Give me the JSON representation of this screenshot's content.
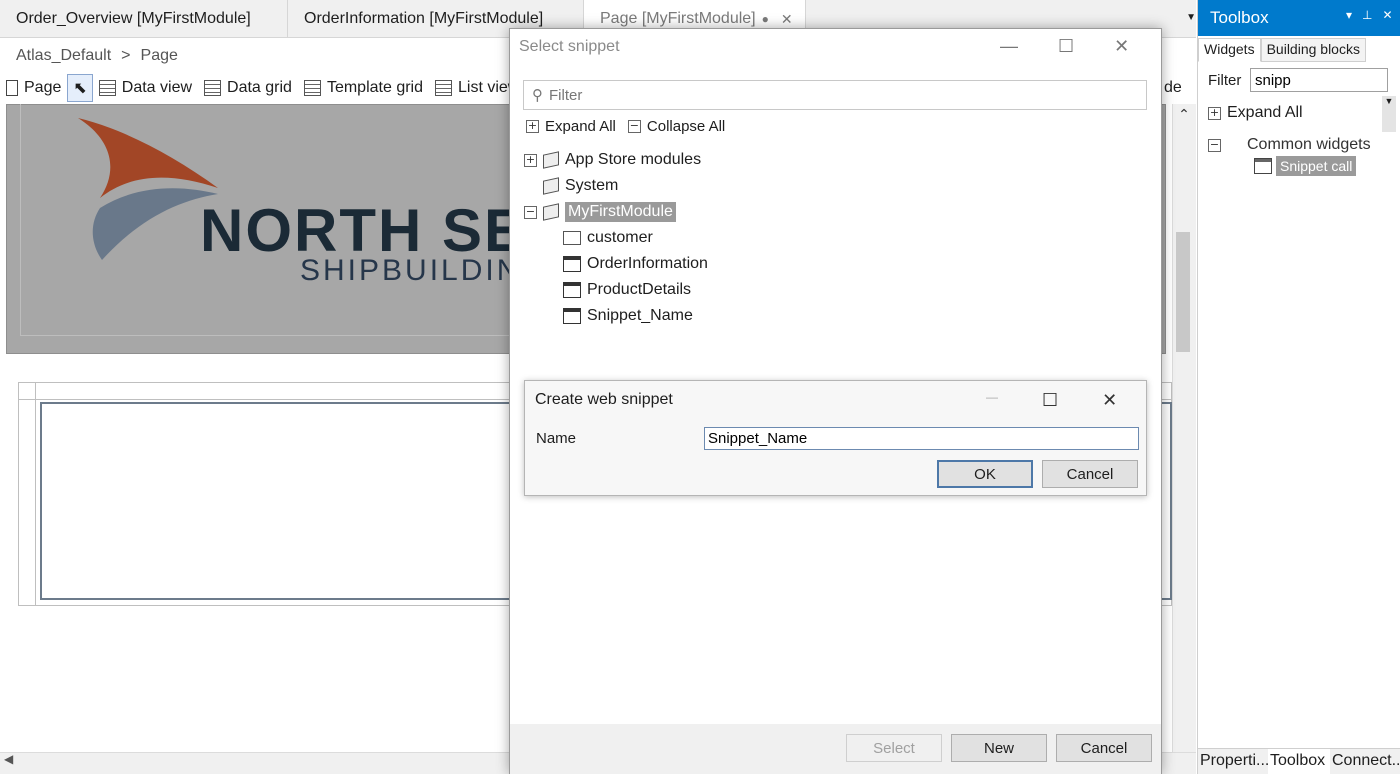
{
  "tabs": [
    {
      "label": "Order_Overview [MyFirstModule]"
    },
    {
      "label": "OrderInformation [MyFirstModule]"
    },
    {
      "label": "Page [MyFirstModule]"
    }
  ],
  "breadcrumb": {
    "first": "Atlas_Default",
    "sep": ">",
    "second": "Page"
  },
  "toolbar": {
    "page": "Page",
    "data_view": "Data view",
    "data_grid": "Data grid",
    "template_grid": "Template grid",
    "list_view": "List view",
    "partial_right": "de"
  },
  "canvas": {
    "logo_line1": "NORTH SEA",
    "logo_line2": "SHIPBUILDING"
  },
  "toolbox": {
    "title": "Toolbox",
    "tab_widgets": "Widgets",
    "tab_building_blocks": "Building blocks",
    "filter_label": "Filter",
    "filter_value": "snipp",
    "expand_all": "Expand All",
    "category": "Common widgets",
    "item": "Snippet call",
    "bottom_tabs": [
      "Properti...",
      "Toolbox",
      "Connect..."
    ]
  },
  "select_snippet": {
    "title": "Select snippet",
    "filter_placeholder": "Filter",
    "expand_all": "Expand All",
    "collapse_all": "Collapse All",
    "tree": {
      "app_store": "App Store modules",
      "system": "System",
      "my_module": "MyFirstModule",
      "children": [
        "customer",
        "OrderInformation",
        "ProductDetails",
        "Snippet_Name"
      ]
    },
    "buttons": {
      "select": "Select",
      "new": "New",
      "cancel": "Cancel"
    }
  },
  "create_snippet": {
    "title": "Create web snippet",
    "name_label": "Name",
    "name_value": "Snippet_Name",
    "ok": "OK",
    "cancel": "Cancel"
  },
  "colors": {
    "accent": "#007acc",
    "logo_red": "#c24a24",
    "logo_blue": "#6f8194",
    "logo_dark": "#1b2a36"
  }
}
